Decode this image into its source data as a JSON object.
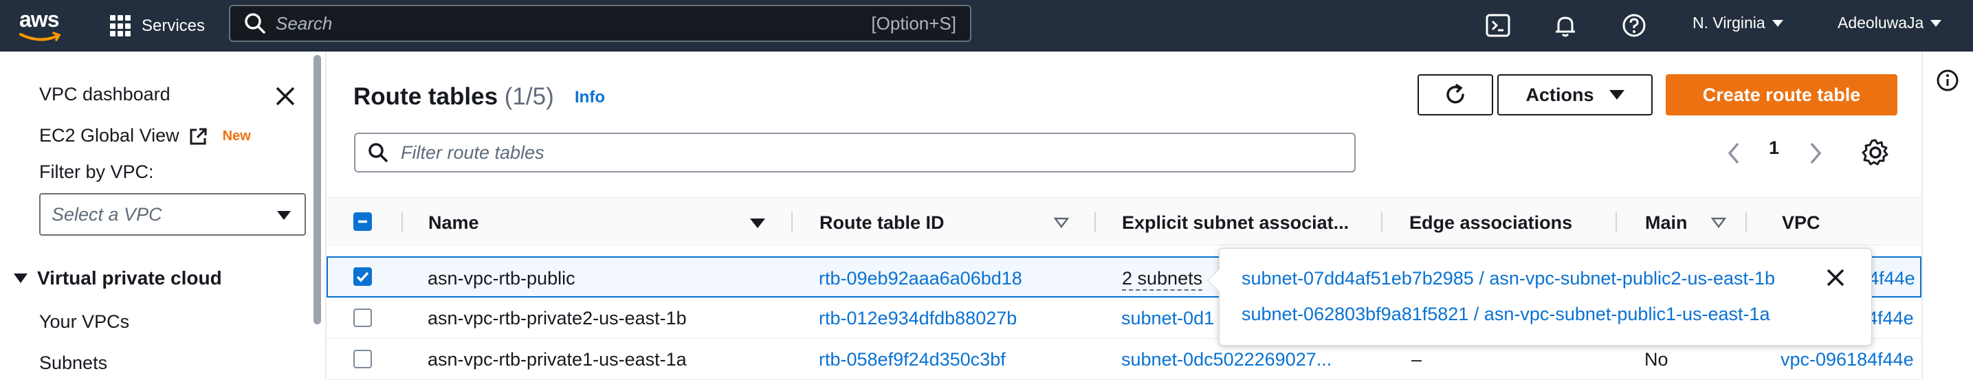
{
  "topnav": {
    "logo_text": "aws",
    "services_label": "Services",
    "search_placeholder": "Search",
    "search_shortcut": "[Option+S]",
    "region": "N. Virginia",
    "user": "AdeoluwaJa"
  },
  "sidenav": {
    "vpc_dashboard": "VPC dashboard",
    "ec2_global_view": "EC2 Global View",
    "new_badge": "New",
    "filter_label": "Filter by VPC:",
    "select_placeholder": "Select a VPC",
    "section_title": "Virtual private cloud",
    "items": [
      "Your VPCs",
      "Subnets"
    ]
  },
  "main": {
    "title": "Route tables",
    "count": "(1/5)",
    "info": "Info",
    "actions_label": "Actions",
    "create_label": "Create route table",
    "filter_placeholder": "Filter route tables",
    "page_number": "1",
    "columns": [
      "Name",
      "Route table ID",
      "Explicit subnet associat...",
      "Edge associations",
      "Main",
      "VPC"
    ],
    "rows": [
      {
        "selected": true,
        "name": "asn-vpc-rtb-public",
        "id": "rtb-09eb92aaa6a06bd18",
        "explicit": "2 subnets",
        "edge": "",
        "main": "",
        "vpc": "vpc-096184f44e"
      },
      {
        "selected": false,
        "name": "asn-vpc-rtb-private2-us-east-1b",
        "id": "rtb-012e934dfdb88027b",
        "explicit": "subnet-0d1",
        "edge": "",
        "main": "",
        "vpc": "vpc-096184f44e"
      },
      {
        "selected": false,
        "name": "asn-vpc-rtb-private1-us-east-1a",
        "id": "rtb-058ef9f24d350c3bf",
        "explicit": "subnet-0dc5022269027...",
        "edge": "–",
        "main": "No",
        "vpc": "vpc-096184f44e"
      }
    ],
    "popover_links": [
      "subnet-07dd4af51eb7b2985 / asn-vpc-subnet-public2-us-east-1b",
      "subnet-062803bf9a81f5821 / asn-vpc-subnet-public1-us-east-1a"
    ]
  },
  "colors": {
    "nav_bg": "#232f3e",
    "link": "#0972d3",
    "primary": "#ec7211",
    "selected_bg": "#f2f8fd"
  }
}
